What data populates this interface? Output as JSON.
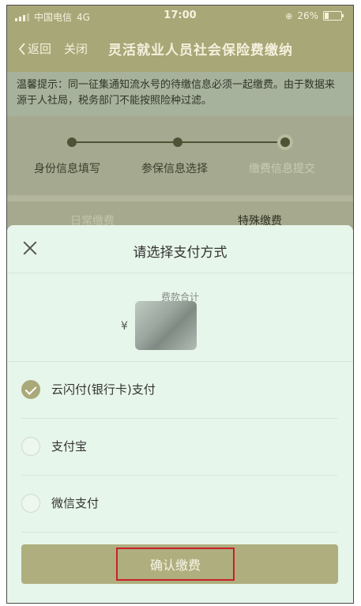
{
  "status_bar": {
    "carrier": "中国电信",
    "network": "4G",
    "time": "17:00",
    "battery": "26%"
  },
  "nav": {
    "back": "返回",
    "close": "关闭",
    "title": "灵活就业人员社会保险费缴纳"
  },
  "notice": {
    "text": "温馨提示：同一征集通知流水号的待缴信息必须一起缴费。由于数据来源于人社局，税务部门不能按照险种过滤。"
  },
  "steps": [
    {
      "label": "身份信息填写"
    },
    {
      "label": "参保信息选择"
    },
    {
      "label": "缴费信息提交"
    }
  ],
  "tabs": {
    "daily": "日常缴费",
    "special": "特殊缴费"
  },
  "sheet": {
    "title": "请选择支付方式",
    "fee_label": "费款合计",
    "currency": "¥",
    "options": [
      {
        "label": "云闪付(银行卡)支付",
        "checked": true
      },
      {
        "label": "支付宝",
        "checked": false
      },
      {
        "label": "微信支付",
        "checked": false
      }
    ],
    "confirm": "确认缴费"
  },
  "colors": {
    "olive": "#a8a777",
    "sheet_bg": "#e7f6ea",
    "highlight": "#c8202a"
  }
}
